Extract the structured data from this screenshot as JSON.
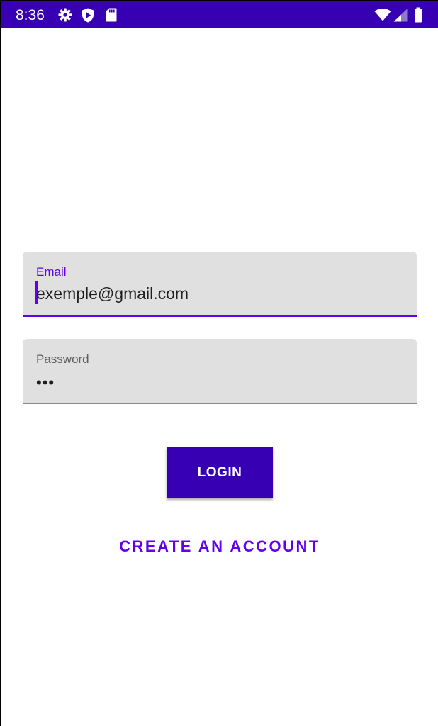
{
  "status_bar": {
    "time": "8:36",
    "icons_left": [
      "gear-icon",
      "shield-play-icon",
      "sd-card-icon"
    ],
    "icons_right": [
      "wifi-icon",
      "cell-signal-icon",
      "battery-icon"
    ],
    "background_color": "#3700b3"
  },
  "login_form": {
    "email": {
      "label": "Email",
      "value": "exemple@gmail.com",
      "focused": true
    },
    "password": {
      "label": "Password",
      "masked_value": "•••"
    },
    "login_button_label": "LOGIN",
    "create_account_label": "CREATE AN ACCOUNT"
  },
  "colors": {
    "primary": "#6200ee",
    "primary_dark": "#3700b3",
    "field_background": "#e0e0e0"
  }
}
